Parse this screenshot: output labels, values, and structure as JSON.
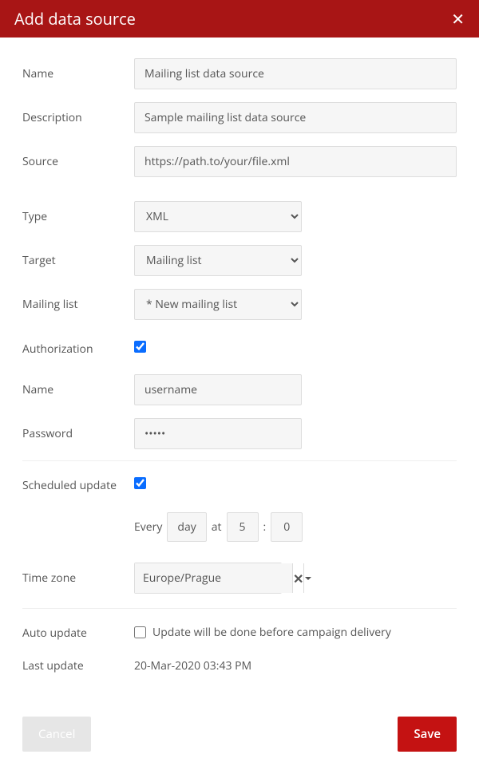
{
  "dialog": {
    "title": "Add data source"
  },
  "labels": {
    "name": "Name",
    "description": "Description",
    "source": "Source",
    "type": "Type",
    "target": "Target",
    "mailing_list": "Mailing list",
    "authorization": "Authorization",
    "auth_name": "Name",
    "password": "Password",
    "scheduled_update": "Scheduled update",
    "every": "Every",
    "at": "at",
    "colon": ":",
    "time_zone": "Time zone",
    "auto_update": "Auto update",
    "last_update": "Last update"
  },
  "fields": {
    "name_value": "Mailing list data source",
    "description_value": "Sample mailing list data source",
    "source_value": "https://path.to/your/file.xml",
    "type_value": "XML",
    "target_value": "Mailing list",
    "mailing_list_value": "* New mailing list",
    "auth_name_value": "username",
    "password_value": "•••••",
    "schedule_unit": "day",
    "schedule_hour": "5",
    "schedule_minute": "0",
    "timezone_value": "Europe/Prague",
    "auto_update_desc": "Update will be done before campaign delivery",
    "last_update_value": "20-Mar-2020 03:43 PM"
  },
  "buttons": {
    "cancel": "Cancel",
    "save": "Save"
  }
}
